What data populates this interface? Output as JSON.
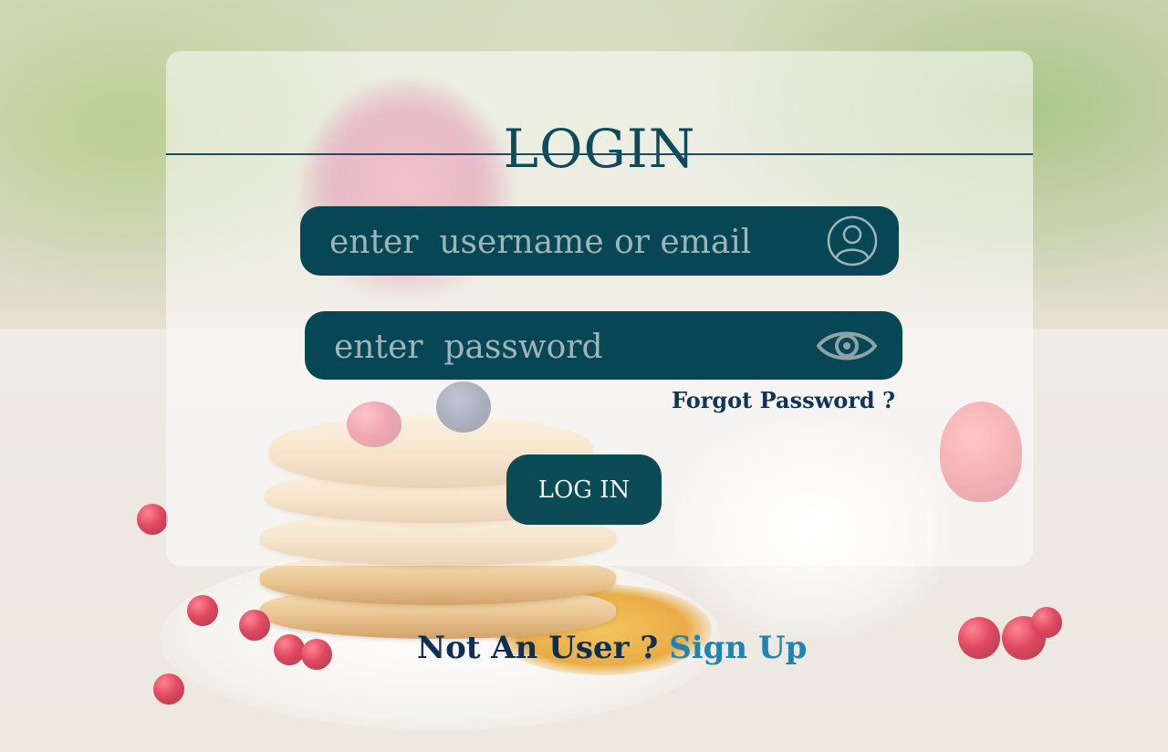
{
  "login_card": {
    "title": "LOGIN",
    "username_field": {
      "placeholder": "enter  username or email",
      "value": "",
      "icon": "user-circle-icon"
    },
    "password_field": {
      "placeholder": "enter  password",
      "value": "",
      "icon": "eye-icon"
    },
    "forgot_password_label": "Forgot Password ?",
    "login_button_label": "LOG IN"
  },
  "signup": {
    "prompt": "Not An User ?",
    "link_label": "Sign Up"
  },
  "colors": {
    "primary_teal": "#074654",
    "title_teal": "#0d4b5a",
    "navy_text": "#0f3559",
    "link_blue": "#1f84b4",
    "card_overlay": "rgba(255,255,255,0.52)"
  },
  "background": {
    "description_icon": "pancake-photo-background"
  }
}
